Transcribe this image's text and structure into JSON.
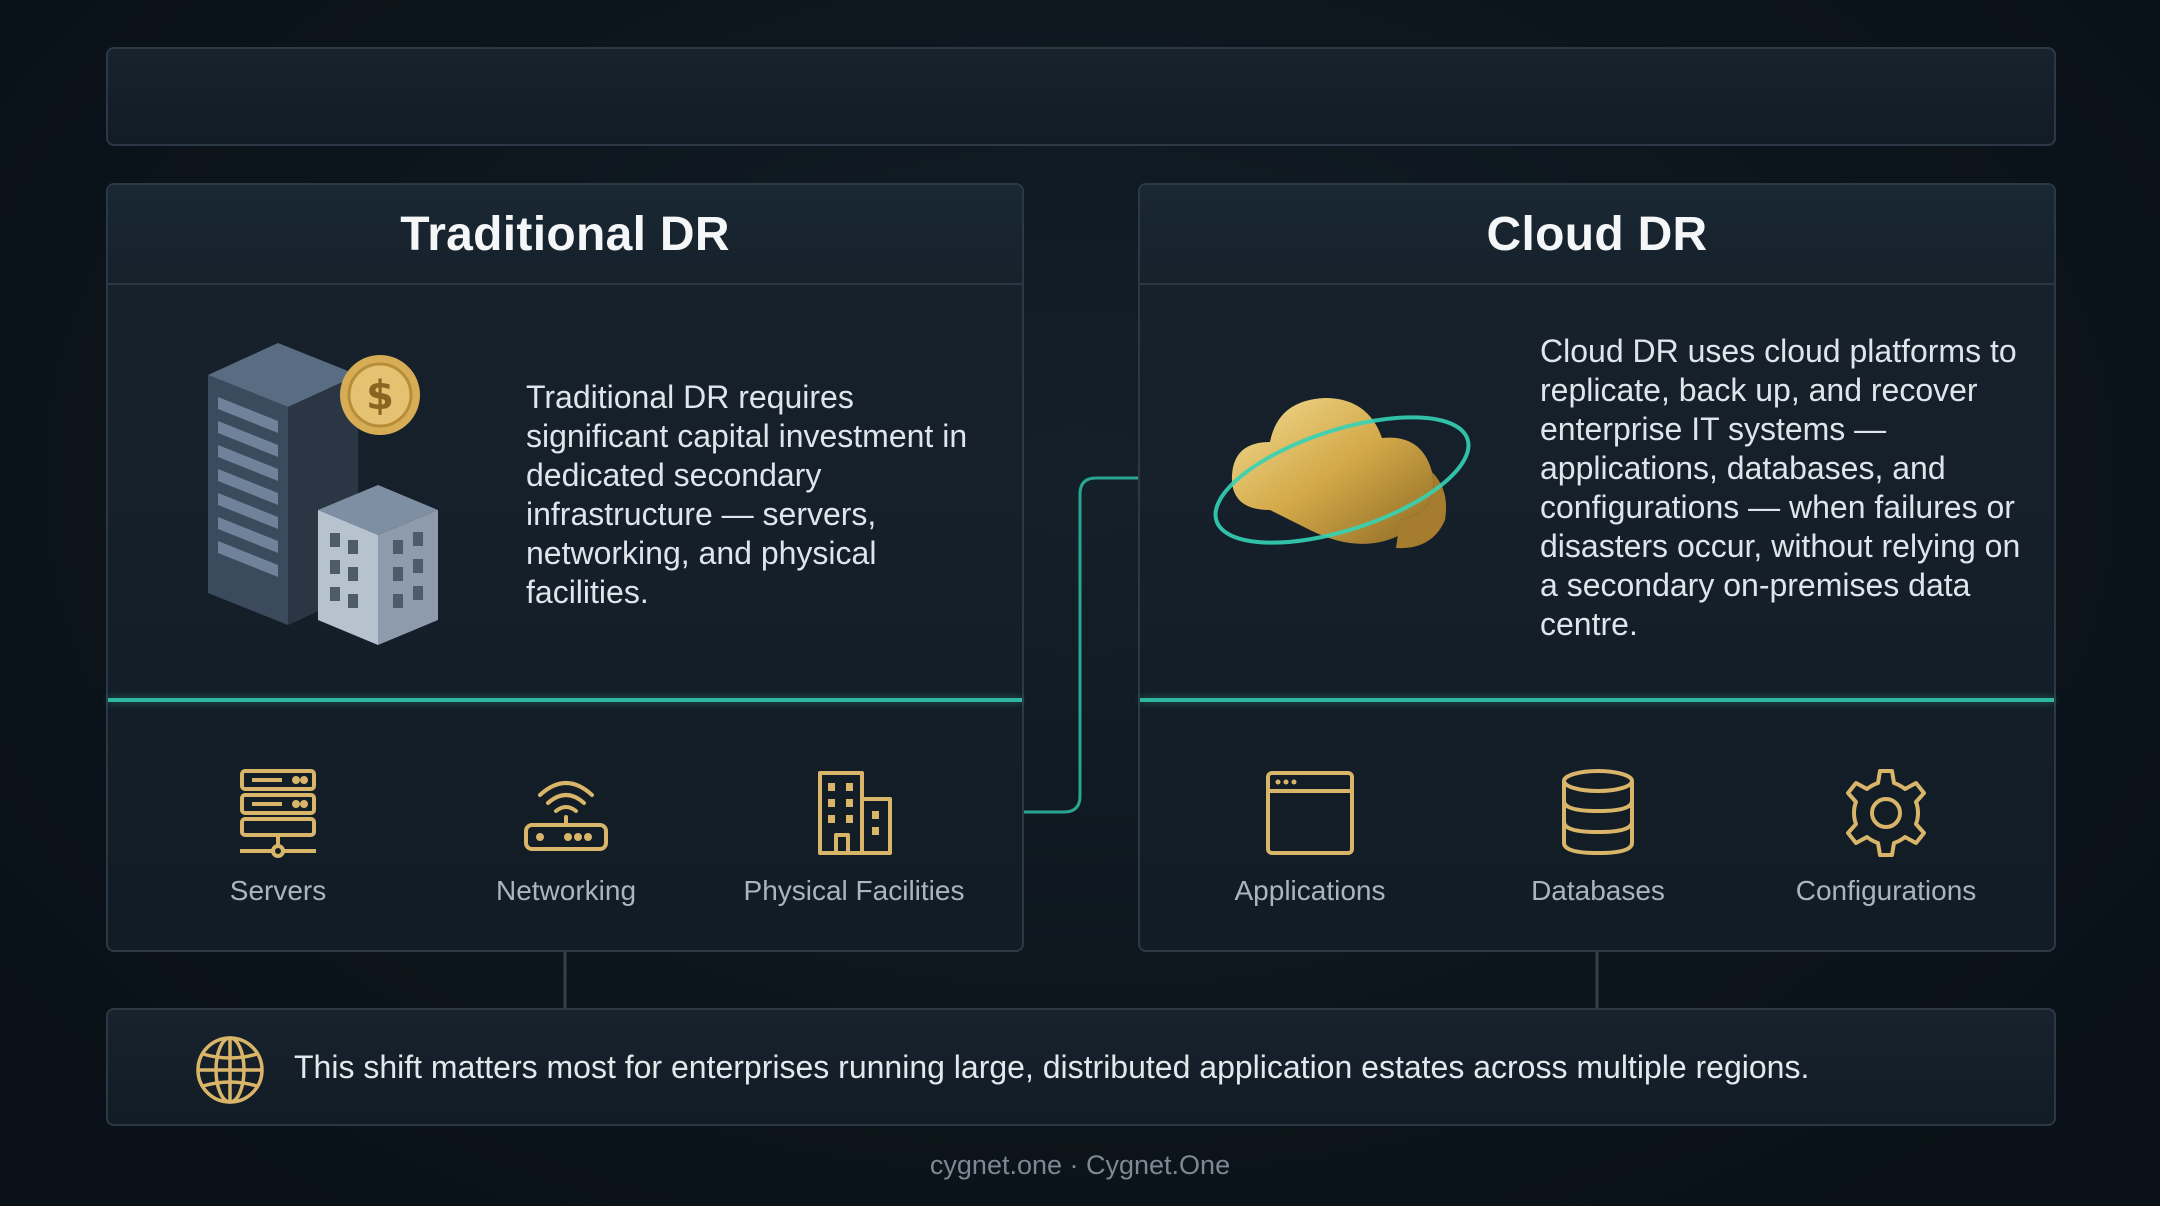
{
  "traditional": {
    "title": "Traditional DR",
    "description": "Traditional DR requires significant capital investment in dedicated secondary infrastructure — servers, networking, and physical facilities.",
    "hero_icons": [
      "server-rack-icon",
      "dollar-coin-icon",
      "office-building-icon"
    ],
    "features": [
      {
        "label": "Servers",
        "icon": "server-stack-icon"
      },
      {
        "label": "Networking",
        "icon": "wifi-router-icon"
      },
      {
        "label": "Physical Facilities",
        "icon": "building-icon"
      }
    ]
  },
  "cloud": {
    "title": "Cloud DR",
    "description": "Cloud DR uses cloud platforms to replicate, back up, and recover enterprise IT systems — applications, databases, and configurations — when failures or disasters occur, without relying on a secondary on-premises data centre.",
    "hero_icons": [
      "gold-cloud-icon",
      "orbit-ring-icon"
    ],
    "features": [
      {
        "label": "Applications",
        "icon": "app-window-icon"
      },
      {
        "label": "Databases",
        "icon": "database-icon"
      },
      {
        "label": "Configurations",
        "icon": "gear-icon"
      }
    ]
  },
  "summary": {
    "icon": "globe-icon",
    "text": "This shift matters most for enterprises running large, distributed application estates across multiple regions."
  },
  "footer": {
    "text": "cygnet.one · Cygnet.One"
  },
  "colors": {
    "accent_teal": "#2fb7a0",
    "icon_gold": "#d9b56a",
    "background": "#0c141b"
  }
}
